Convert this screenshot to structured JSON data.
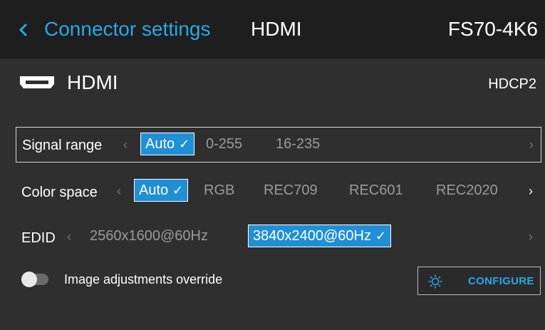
{
  "header": {
    "back_label": "Connector settings",
    "title": "HDMI",
    "device": "FS70-4K6"
  },
  "connector": {
    "icon": "hdmi-port-icon",
    "name": "HDMI",
    "hdcp": "HDCP2"
  },
  "settings": {
    "signal_range": {
      "label": "Signal range",
      "options": [
        "Auto",
        "0-255",
        "16-235"
      ],
      "selected": "Auto"
    },
    "color_space": {
      "label": "Color space",
      "options": [
        "Auto",
        "RGB",
        "REC709",
        "REC601",
        "REC2020"
      ],
      "selected": "Auto"
    },
    "edid": {
      "label": "EDID",
      "options": [
        "2560x1600@60Hz",
        "3840x2400@60Hz"
      ],
      "selected": "3840x2400@60Hz"
    }
  },
  "image_adjustments": {
    "label": "Image adjustments override",
    "enabled": false
  },
  "configure_button": {
    "label": "CONFIGURE"
  },
  "colors": {
    "accent": "#2aa7e8",
    "selected_bg": "#1f8fd6",
    "background": "#2f2f2f",
    "header_bg": "#1e1e1e"
  }
}
